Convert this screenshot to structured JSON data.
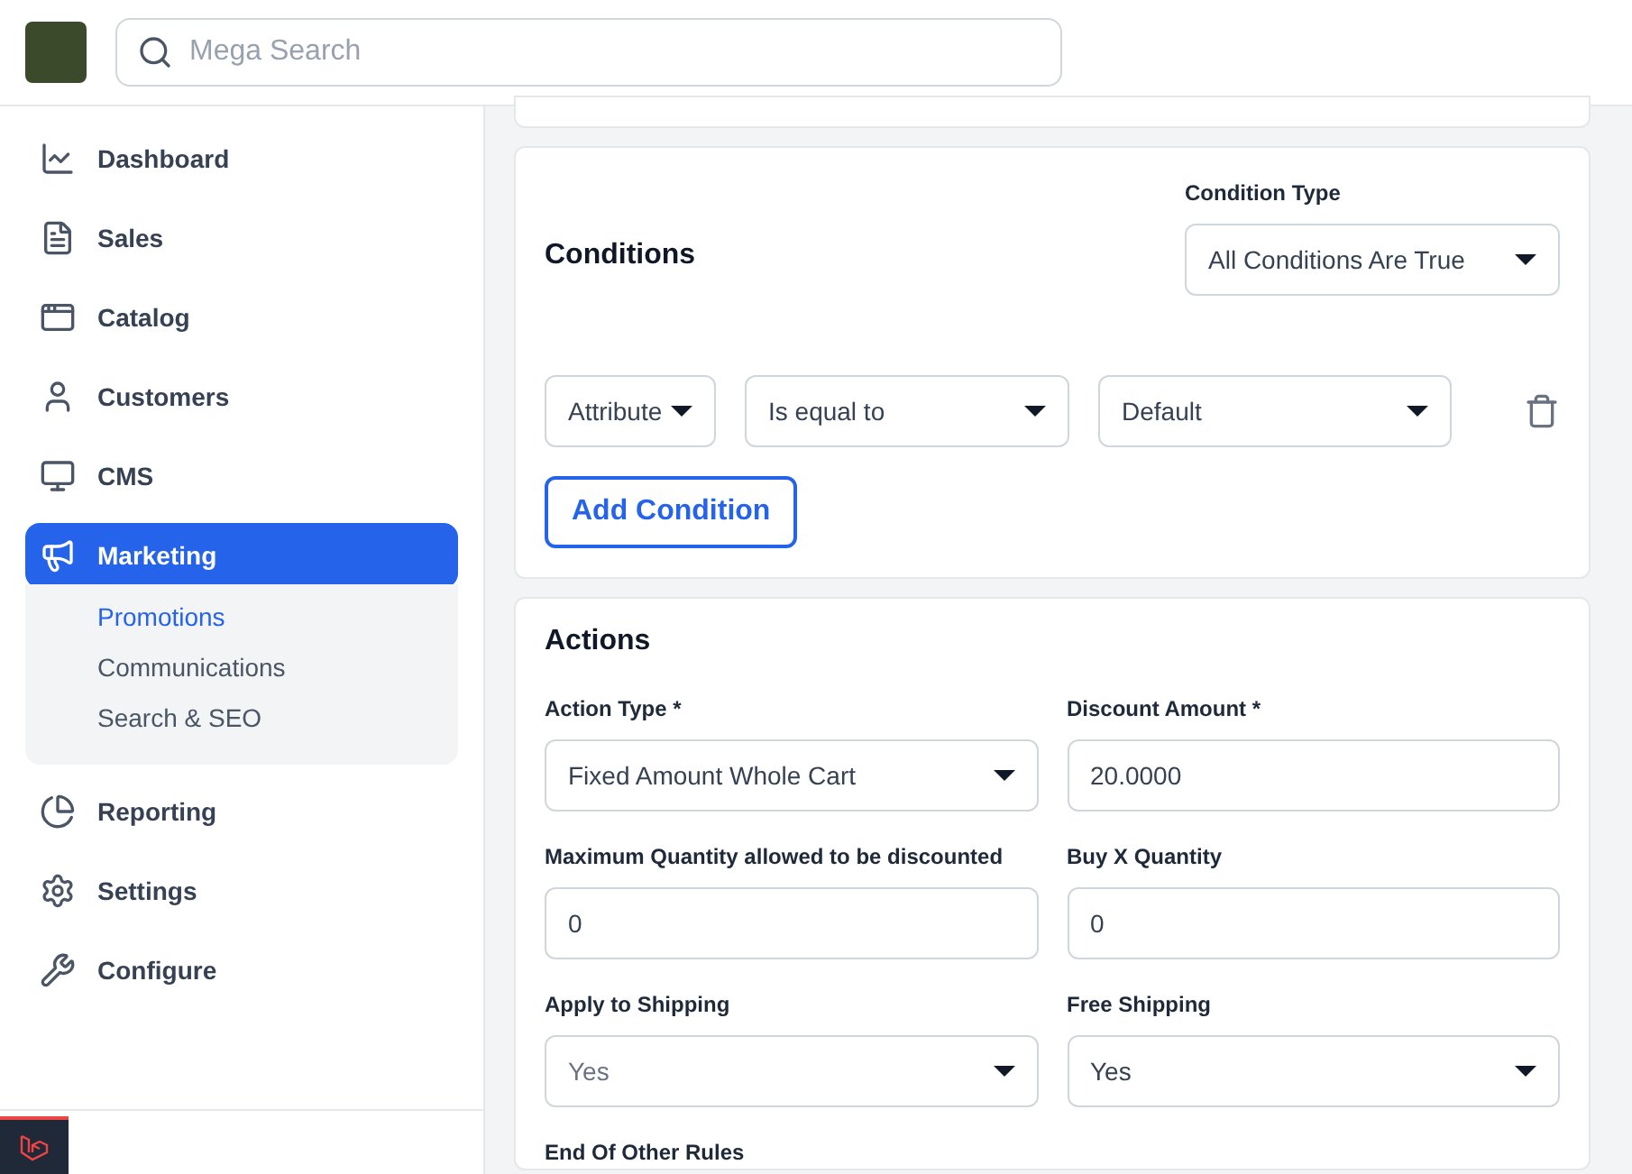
{
  "header": {
    "search": {
      "placeholder": "Mega Search"
    }
  },
  "sidebar": {
    "items": [
      {
        "label": "Dashboard",
        "selected": false
      },
      {
        "label": "Sales",
        "selected": false
      },
      {
        "label": "Catalog",
        "selected": false
      },
      {
        "label": "Customers",
        "selected": false
      },
      {
        "label": "CMS",
        "selected": false
      },
      {
        "label": "Marketing",
        "selected": true,
        "children": [
          {
            "label": "Promotions",
            "selected": true
          },
          {
            "label": "Communications",
            "selected": false
          },
          {
            "label": "Search & SEO",
            "selected": false
          }
        ]
      },
      {
        "label": "Reporting",
        "selected": false
      },
      {
        "label": "Settings",
        "selected": false
      },
      {
        "label": "Configure",
        "selected": false
      }
    ]
  },
  "conditions": {
    "title": "Conditions",
    "condition_type": {
      "label": "Condition Type",
      "value": "All Conditions Are True"
    },
    "rows": [
      {
        "attribute": "Attribute",
        "operator": "Is equal to",
        "value": "Default"
      }
    ],
    "add_button": "Add Condition"
  },
  "actions": {
    "title": "Actions",
    "fields": [
      {
        "label": "Action Type *",
        "kind": "select",
        "value": "Fixed Amount Whole Cart",
        "disabled": false
      },
      {
        "label": "Discount Amount *",
        "kind": "input",
        "value": "20.0000",
        "disabled": false
      },
      {
        "label": "Maximum Quantity allowed to be discounted",
        "kind": "input",
        "value": "0",
        "disabled": false
      },
      {
        "label": "Buy X Quantity",
        "kind": "input",
        "value": "0",
        "disabled": false
      },
      {
        "label": "Apply to Shipping",
        "kind": "select",
        "value": "Yes",
        "disabled": true
      },
      {
        "label": "Free Shipping",
        "kind": "select",
        "value": "Yes",
        "disabled": false
      },
      {
        "label": "End Of Other Rules"
      }
    ]
  }
}
